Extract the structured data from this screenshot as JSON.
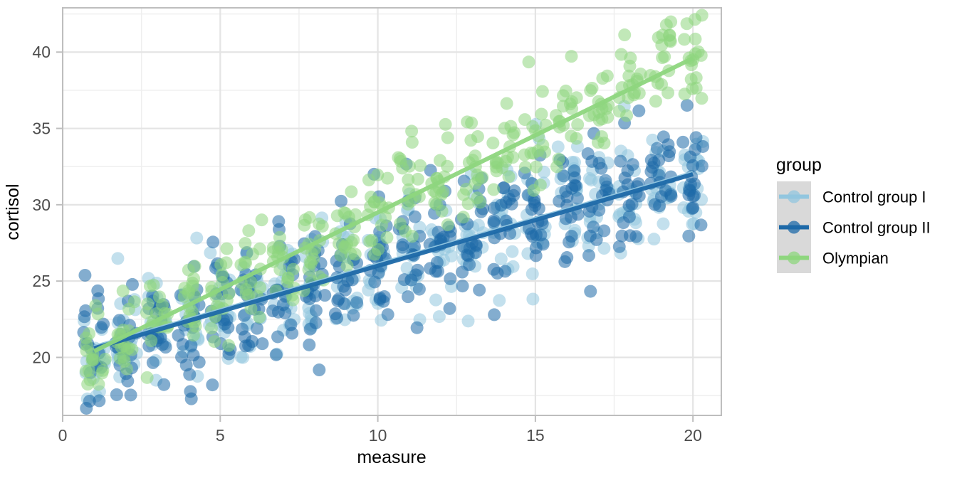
{
  "chart_data": {
    "type": "scatter",
    "title": "",
    "xlabel": "measure",
    "ylabel": "cortisol",
    "xlim": [
      0.0,
      20.9
    ],
    "ylim": [
      16.2,
      42.9
    ],
    "x_ticks": [
      0,
      5,
      10,
      15,
      20
    ],
    "x_tick_labels": [
      "0",
      "5",
      "10",
      "15",
      "20"
    ],
    "y_ticks": [
      20,
      25,
      30,
      35,
      40
    ],
    "y_tick_labels": [
      "20",
      "25",
      "30",
      "35",
      "40"
    ],
    "x_minor_ticks": [
      2.5,
      7.5,
      12.5,
      17.5
    ],
    "y_minor_ticks": [
      17.5,
      22.5,
      27.5,
      32.5,
      37.5,
      42.5
    ],
    "grid": true,
    "legend_position": "right",
    "legend_title": "group",
    "x_categories": [
      1,
      2,
      3,
      4,
      5,
      6,
      7,
      8,
      9,
      10,
      11,
      12,
      13,
      14,
      15,
      16,
      17,
      18,
      19,
      20
    ],
    "jitter_width": 0.35,
    "point_size": 9,
    "point_opacity": 0.55,
    "series": [
      {
        "name": "Control group I",
        "color": "#92C6DF",
        "points_per_x": 18,
        "trend": {
          "intercept": 20.1,
          "slope": 0.6,
          "sd": 2.0,
          "line_width": 5
        },
        "values": [
          {
            "x": 1,
            "mean": 20.7
          },
          {
            "x": 2,
            "mean": 21.3
          },
          {
            "x": 3,
            "mean": 21.9
          },
          {
            "x": 4,
            "mean": 22.5
          },
          {
            "x": 5,
            "mean": 23.1
          },
          {
            "x": 6,
            "mean": 23.7
          },
          {
            "x": 7,
            "mean": 24.3
          },
          {
            "x": 8,
            "mean": 24.9
          },
          {
            "x": 9,
            "mean": 25.5
          },
          {
            "x": 10,
            "mean": 26.1
          },
          {
            "x": 11,
            "mean": 26.7
          },
          {
            "x": 12,
            "mean": 27.3
          },
          {
            "x": 13,
            "mean": 27.9
          },
          {
            "x": 14,
            "mean": 28.5
          },
          {
            "x": 15,
            "mean": 29.1
          },
          {
            "x": 16,
            "mean": 29.7
          },
          {
            "x": 17,
            "mean": 30.3
          },
          {
            "x": 18,
            "mean": 30.9
          },
          {
            "x": 19,
            "mean": 31.5
          },
          {
            "x": 20,
            "mean": 32.1
          }
        ]
      },
      {
        "name": "Control group II",
        "color": "#1D69A8",
        "points_per_x": 20,
        "trend": {
          "intercept": 20.0,
          "slope": 0.6,
          "sd": 2.1,
          "line_width": 6
        },
        "values": [
          {
            "x": 1,
            "mean": 20.6
          },
          {
            "x": 2,
            "mean": 21.2
          },
          {
            "x": 3,
            "mean": 21.8
          },
          {
            "x": 4,
            "mean": 22.4
          },
          {
            "x": 5,
            "mean": 23.0
          },
          {
            "x": 6,
            "mean": 23.6
          },
          {
            "x": 7,
            "mean": 24.2
          },
          {
            "x": 8,
            "mean": 24.8
          },
          {
            "x": 9,
            "mean": 25.4
          },
          {
            "x": 10,
            "mean": 26.0
          },
          {
            "x": 11,
            "mean": 26.6
          },
          {
            "x": 12,
            "mean": 27.2
          },
          {
            "x": 13,
            "mean": 27.8
          },
          {
            "x": 14,
            "mean": 28.4
          },
          {
            "x": 15,
            "mean": 29.0
          },
          {
            "x": 16,
            "mean": 29.6
          },
          {
            "x": 17,
            "mean": 30.2
          },
          {
            "x": 18,
            "mean": 30.8
          },
          {
            "x": 19,
            "mean": 31.4
          },
          {
            "x": 20,
            "mean": 32.0
          }
        ]
      },
      {
        "name": "Olympian",
        "color": "#8ED67E",
        "points_per_x": 18,
        "trend": {
          "intercept": 19.4,
          "slope": 1.01,
          "sd": 1.5,
          "line_width": 6
        },
        "values": [
          {
            "x": 1,
            "mean": 20.4
          },
          {
            "x": 2,
            "mean": 21.4
          },
          {
            "x": 3,
            "mean": 22.4
          },
          {
            "x": 4,
            "mean": 23.4
          },
          {
            "x": 5,
            "mean": 24.4
          },
          {
            "x": 6,
            "mean": 25.4
          },
          {
            "x": 7,
            "mean": 26.4
          },
          {
            "x": 8,
            "mean": 27.4
          },
          {
            "x": 9,
            "mean": 28.4
          },
          {
            "x": 10,
            "mean": 29.5
          },
          {
            "x": 11,
            "mean": 30.5
          },
          {
            "x": 12,
            "mean": 31.5
          },
          {
            "x": 13,
            "mean": 32.5
          },
          {
            "x": 14,
            "mean": 33.5
          },
          {
            "x": 15,
            "mean": 34.5
          },
          {
            "x": 16,
            "mean": 35.5
          },
          {
            "x": 17,
            "mean": 36.5
          },
          {
            "x": 18,
            "mean": 37.5
          },
          {
            "x": 19,
            "mean": 38.5
          },
          {
            "x": 20,
            "mean": 39.5
          }
        ]
      }
    ]
  },
  "legend": {
    "title": "group",
    "items": [
      {
        "label": "Control group I",
        "color": "#92C6DF"
      },
      {
        "label": "Control group II",
        "color": "#1D69A8"
      },
      {
        "label": "Olympian",
        "color": "#8ED67E"
      }
    ],
    "key_background": "#D9D9D9"
  },
  "axes": {
    "x_title": "measure",
    "y_title": "cortisol"
  },
  "theme": {
    "panel_background": "#FFFFFF",
    "panel_border": "#BEBEBE",
    "grid_major": "#E4E4E4",
    "grid_minor": "#EFEFEF",
    "tick_color": "#BEBEBE",
    "text_color": "#4D4D4D"
  }
}
